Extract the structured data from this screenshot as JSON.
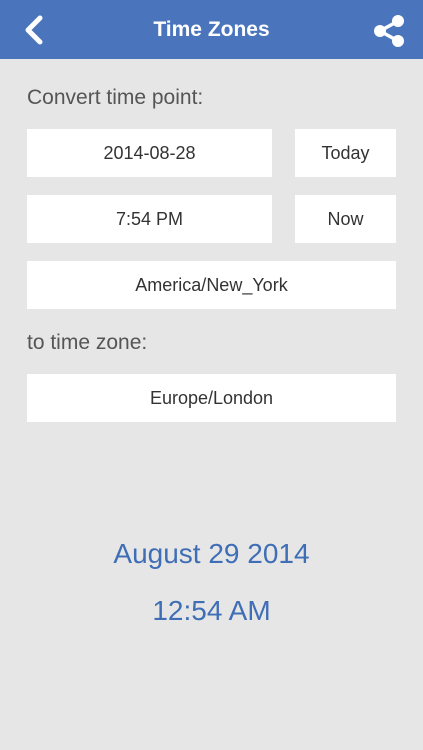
{
  "nav": {
    "title": "Time Zones",
    "back_icon": "chevron-left-icon",
    "share_icon": "share-icon",
    "color": "#4a75bc"
  },
  "convert": {
    "label": "Convert time point:",
    "date_value": "2014-08-28",
    "today_label": "Today",
    "time_value": "7:54 PM",
    "now_label": "Now",
    "source_zone": "America/New_York"
  },
  "target": {
    "label": "to time zone:",
    "zone": "Europe/London"
  },
  "result": {
    "date": "August 29 2014",
    "time": "12:54 AM",
    "color": "#3f6eb6"
  }
}
